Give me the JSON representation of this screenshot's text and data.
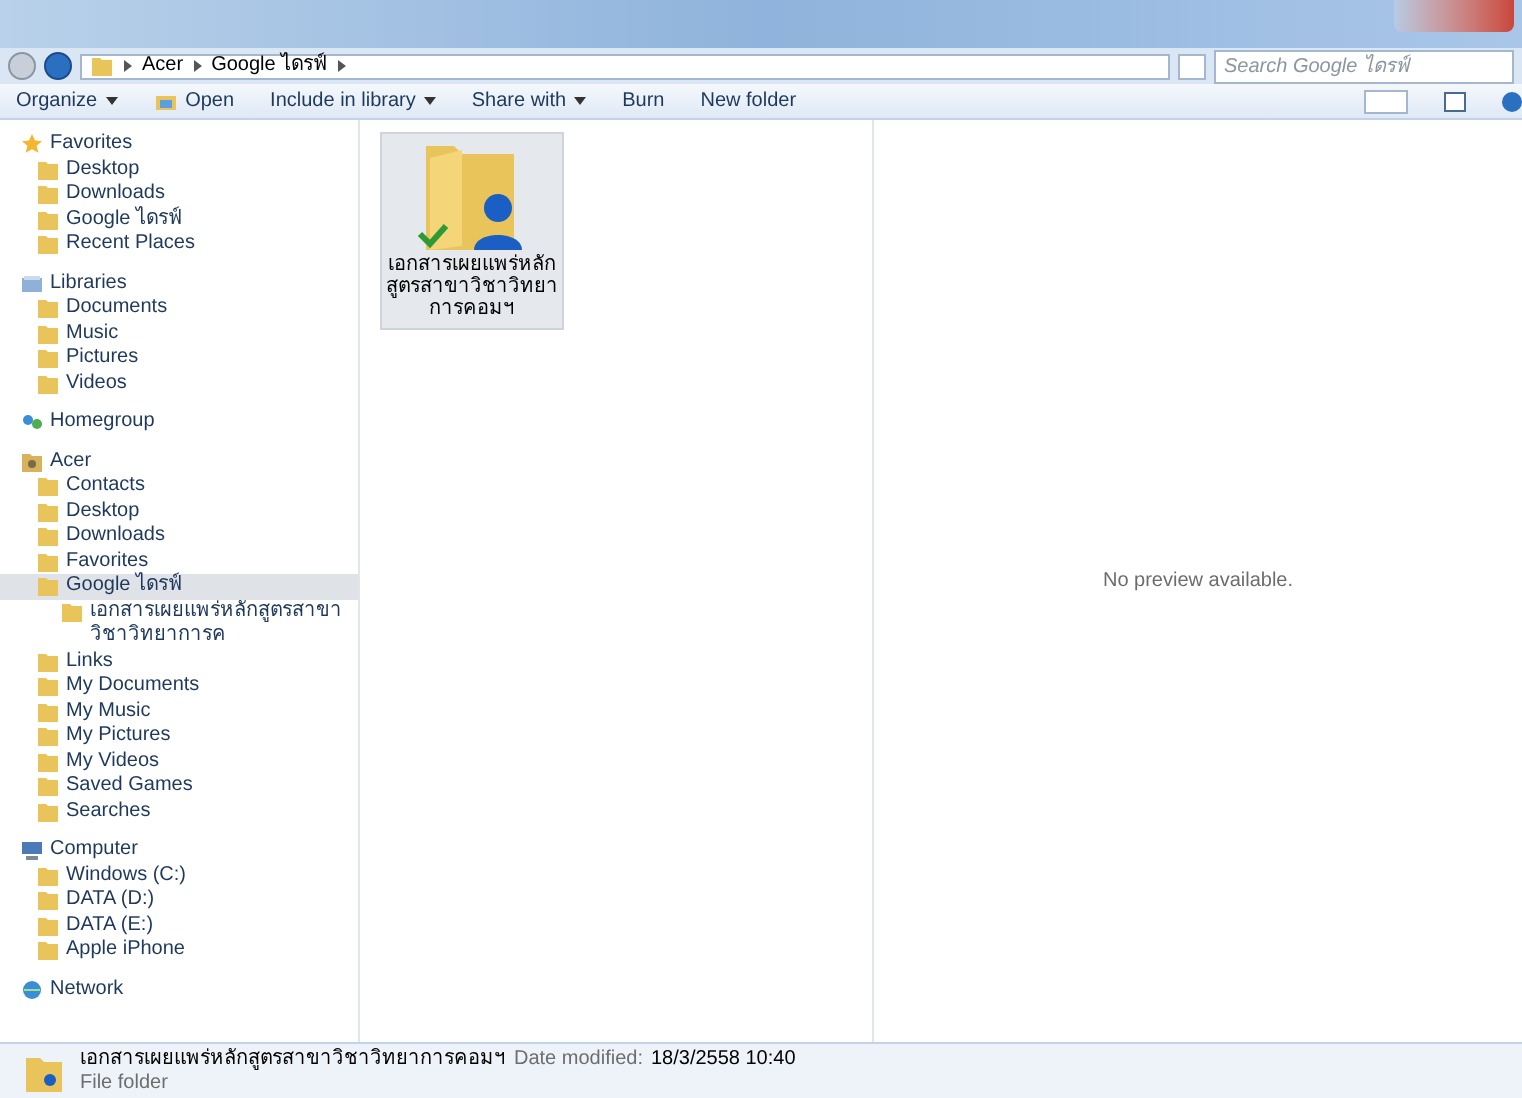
{
  "address_bar": {
    "breadcrumbs": [
      "Acer",
      "Google ไดรฟ์"
    ],
    "search": {
      "placeholder": "Search Google ไดรฟ์"
    }
  },
  "toolbar": {
    "buttons": [
      {
        "label": "Organize",
        "kind": "menu"
      },
      {
        "label": "Open",
        "kind": "icon"
      },
      {
        "label": "Include in library",
        "kind": "menu"
      },
      {
        "label": "Share with",
        "kind": "menu"
      },
      {
        "label": "Burn",
        "kind": "plain"
      },
      {
        "label": "New folder",
        "kind": "plain"
      }
    ]
  },
  "sidebar": {
    "groups": [
      {
        "label": "Favorites",
        "items": [
          {
            "label": "Desktop",
            "selected": false
          },
          {
            "label": "Downloads",
            "selected": false
          },
          {
            "label": "Google ไดรฟ์",
            "selected": false
          },
          {
            "label": "Recent Places",
            "selected": false
          }
        ]
      },
      {
        "label": "Libraries",
        "items": [
          {
            "label": "Documents",
            "selected": false
          },
          {
            "label": "Music",
            "selected": false
          },
          {
            "label": "Pictures",
            "selected": false
          },
          {
            "label": "Videos",
            "selected": false
          }
        ]
      },
      {
        "label": "Homegroup"
      },
      {
        "label": "Acer",
        "items": [
          {
            "label": "Contacts",
            "selected": false
          },
          {
            "label": "Desktop",
            "selected": false
          },
          {
            "label": "Downloads",
            "selected": false
          },
          {
            "label": "Favorites",
            "selected": false
          },
          {
            "label": "Google ไดรฟ์",
            "selected": true,
            "children": [
              {
                "label": "เอกสารเผยแพร่หลักสูตรสาขาวิชาวิทยาการค",
                "selected": false
              }
            ]
          },
          {
            "label": "Links",
            "selected": false
          },
          {
            "label": "My Documents",
            "selected": false
          },
          {
            "label": "My Music",
            "selected": false
          },
          {
            "label": "My Pictures",
            "selected": false
          },
          {
            "label": "My Videos",
            "selected": false
          },
          {
            "label": "Saved Games",
            "selected": false
          },
          {
            "label": "Searches",
            "selected": false
          }
        ]
      },
      {
        "label": "Computer",
        "items": [
          {
            "label": "Windows (C:)",
            "selected": false
          },
          {
            "label": "DATA (D:)",
            "selected": false
          },
          {
            "label": "DATA (E:)",
            "selected": false
          },
          {
            "label": "Apple iPhone",
            "selected": false
          }
        ]
      },
      {
        "label": "Network"
      }
    ]
  },
  "files": [
    {
      "lines": [
        "เอกสารเผยแพร่หลัก",
        "สูตรสาขาวิชาวิทยา",
        "การคอมฯ"
      ],
      "selected": true,
      "synced": true
    }
  ],
  "preview": {
    "message": "No preview available."
  },
  "status_bar": {
    "name": "เอกสารเผยแพร่หลักสูตรสาขาวิชาวิทยาการคอมฯ",
    "date_label": "Date modified:",
    "date": "18/3/2558 10:40",
    "type": "File folder"
  }
}
